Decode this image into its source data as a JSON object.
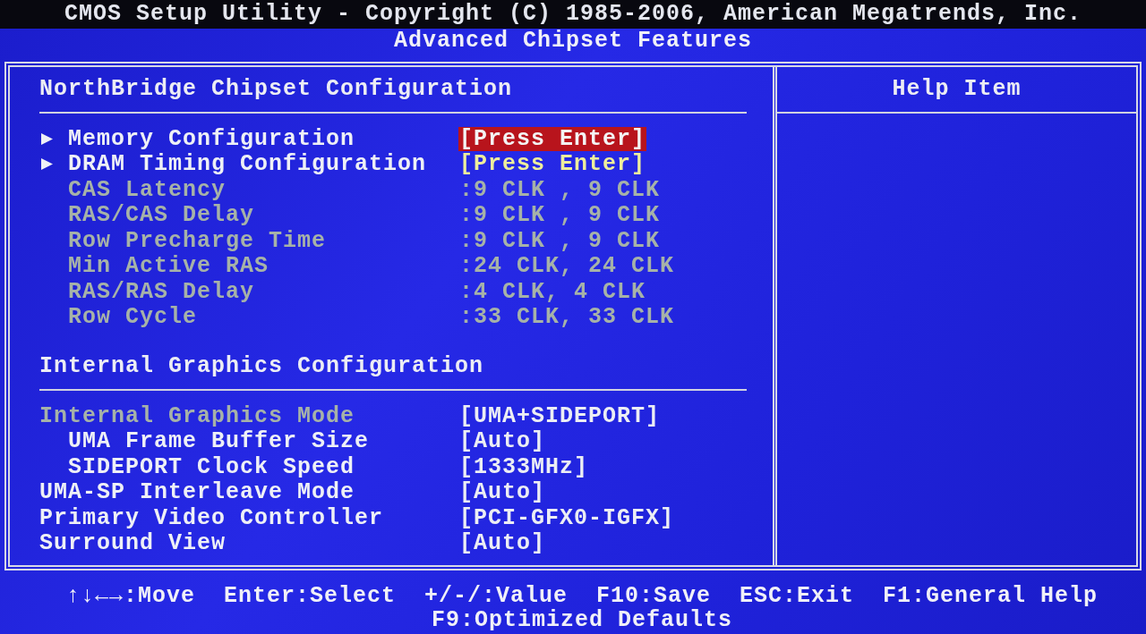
{
  "title_bar": {
    "title": "CMOS Setup Utility - Copyright (C) 1985-2006, American Megatrends, Inc."
  },
  "page_title": "Advanced Chipset Features",
  "sections": [
    {
      "heading": "NorthBridge Chipset Configuration",
      "items": [
        {
          "kind": "submenu",
          "label": "Memory Configuration",
          "value": "[Press Enter]",
          "disabled": false,
          "selected": true
        },
        {
          "kind": "submenu",
          "label": "DRAM Timing Configuration",
          "value": "[Press Enter]",
          "disabled": false,
          "selected": false
        },
        {
          "kind": "info",
          "label": "CAS Latency",
          "value": ":9 CLK , 9 CLK",
          "disabled": true,
          "selected": false
        },
        {
          "kind": "info",
          "label": "RAS/CAS Delay",
          "value": ":9 CLK , 9 CLK",
          "disabled": true,
          "selected": false
        },
        {
          "kind": "info",
          "label": "Row Precharge Time",
          "value": ":9 CLK , 9 CLK",
          "disabled": true,
          "selected": false
        },
        {
          "kind": "info",
          "label": "Min Active RAS",
          "value": ":24 CLK, 24 CLK",
          "disabled": true,
          "selected": false
        },
        {
          "kind": "info",
          "label": "RAS/RAS Delay",
          "value": ":4 CLK, 4 CLK",
          "disabled": true,
          "selected": false
        },
        {
          "kind": "info",
          "label": "Row Cycle",
          "value": ":33 CLK, 33 CLK",
          "disabled": true,
          "selected": false
        }
      ]
    },
    {
      "heading": "Internal Graphics Configuration",
      "items": [
        {
          "kind": "option",
          "label": "Internal Graphics Mode",
          "value": "[UMA+SIDEPORT]",
          "disabled": true,
          "selected": false,
          "children": [
            {
              "kind": "option",
              "label": "UMA Frame Buffer Size",
              "value": "[Auto]",
              "disabled": false,
              "selected": false
            },
            {
              "kind": "option",
              "label": "SIDEPORT Clock Speed",
              "value": "[1333MHz]",
              "disabled": false,
              "selected": false
            }
          ]
        },
        {
          "kind": "option",
          "label": "UMA-SP Interleave Mode",
          "value": "[Auto]",
          "disabled": false,
          "selected": false
        },
        {
          "kind": "option",
          "label": "Primary Video Controller",
          "value": "[PCI-GFX0-IGFX]",
          "disabled": false,
          "selected": false
        },
        {
          "kind": "option",
          "label": "Surround View",
          "value": "[Auto]",
          "disabled": false,
          "selected": false
        }
      ]
    }
  ],
  "help": {
    "heading": "Help Item"
  },
  "footer": {
    "hints": [
      "↑↓←→:Move",
      "Enter:Select",
      "+/-/:Value",
      "F10:Save",
      "ESC:Exit",
      "F1:General Help",
      "F9:Optimized Defaults"
    ]
  }
}
